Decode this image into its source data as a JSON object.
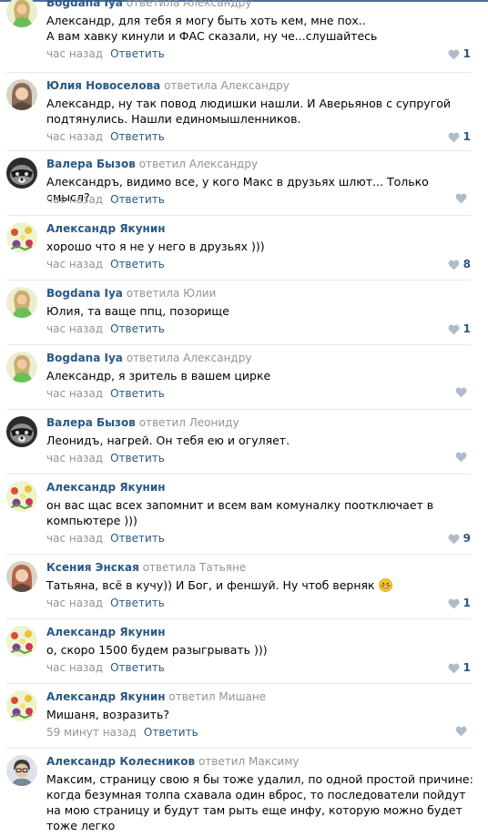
{
  "comments": [
    {
      "author": "Bogdana Iya",
      "replied": "ответила Александру",
      "text": "Александр, для тебя я могу быть хоть кем, мне пох..\nА вам хавку кинули и ФАС сказали, ну че...слушайтесь",
      "time": "час назад",
      "reply": "Ответить",
      "likes": "1",
      "avatar": "girl-photo",
      "accent": "#c7d38a"
    },
    {
      "author": "Юлия Новоселова",
      "replied": "ответила Александру",
      "text": "Александр, ну так повод людишки нашли. И Аверьянов с супругой подтянулись. Нашли единомышленников.",
      "time": "час назад",
      "reply": "Ответить",
      "likes": "1",
      "avatar": "woman-photo",
      "accent": "#8a6b55"
    },
    {
      "author": "Валера Бызов",
      "replied": "ответил Александру",
      "text": "Александръ, видимо все, у кого Макс в друзьях шлют... Только смысл?",
      "time": "час назад",
      "reply": "Ответить",
      "likes": "",
      "avatar": "raccoon-photo",
      "accent": "#444444"
    },
    {
      "author": "Александр Якунин",
      "replied": "",
      "text": "хорошо что я не у него в друзьях )))",
      "time": "час назад",
      "reply": "Ответить",
      "likes": "8",
      "avatar": "flowers-photo",
      "accent": "#d5e38c"
    },
    {
      "author": "Bogdana Iya",
      "replied": "ответила Юлии",
      "text": "Юлия, та ваще ппц, позорище",
      "time": "час назад",
      "reply": "Ответить",
      "likes": "1",
      "avatar": "girl-photo",
      "accent": "#c7d38a"
    },
    {
      "author": "Bogdana Iya",
      "replied": "ответила Александру",
      "text": "Александр, я зритель в вашем цирке",
      "time": "час назад",
      "reply": "Ответить",
      "likes": "",
      "avatar": "girl-photo",
      "accent": "#c7d38a"
    },
    {
      "author": "Валера Бызов",
      "replied": "ответил Леониду",
      "text": "Леонидъ, нагрей. Он тебя ею и огуляет.",
      "time": "час назад",
      "reply": "Ответить",
      "likes": "",
      "avatar": "raccoon-photo",
      "accent": "#444444"
    },
    {
      "author": "Александр Якунин",
      "replied": "",
      "text": "он вас щас всех запомнит и всем вам комуналку поотключает в компьютере )))",
      "time": "час назад",
      "reply": "Ответить",
      "likes": "9",
      "avatar": "flowers-photo",
      "accent": "#d5e38c"
    },
    {
      "author": "Ксения Энская",
      "replied": "ответила Татьяне",
      "text": "Татьяна, всё в кучу)) И Бог, и феншуй. Ну чтоб верняк",
      "emoji": "grinning-emoji",
      "time": "час назад",
      "reply": "Ответить",
      "likes": "1",
      "avatar": "woman-photo",
      "accent": "#b5634a"
    },
    {
      "author": "Александр Якунин",
      "replied": "",
      "text": "о, скоро 1500 будем разыгрывать )))",
      "time": "час назад",
      "reply": "Ответить",
      "likes": "1",
      "avatar": "flowers-photo",
      "accent": "#d5e38c"
    },
    {
      "author": "Александр Якунин",
      "replied": "ответил Мишане",
      "text": "Мишаня, возразить?",
      "time": "59 минут назад",
      "reply": "Ответить",
      "likes": "",
      "avatar": "flowers-photo",
      "accent": "#d5e38c"
    },
    {
      "author": "Александр Колесников",
      "replied": "ответил Максиму",
      "text": "Максим, страницу свою я бы тоже удалил, по одной простой причине: когда безумная толпа схавала один вброс, то последователи пойдут на мою страницу и будут там рыть еще инфу, которую можно будет тоже легко",
      "time": "",
      "reply": "",
      "likes": "",
      "avatar": "man-glasses-photo",
      "accent": "#7a8796"
    }
  ],
  "colors": {
    "link": "#2a5885",
    "muted": "#939393",
    "separator": "#e7e8ec",
    "heart": "#b0bccb"
  }
}
